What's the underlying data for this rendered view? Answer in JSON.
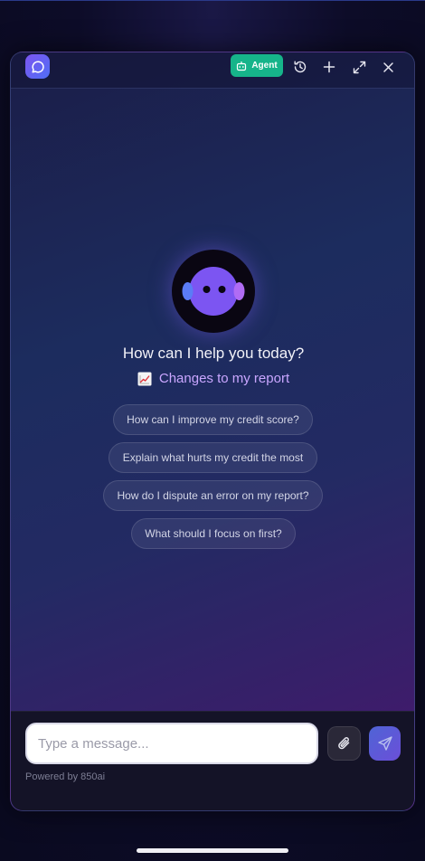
{
  "header": {
    "agent_label": "Agent"
  },
  "hero": {
    "greeting": "How can I help you today?",
    "report_link": "Changes to my report"
  },
  "suggestions": [
    "How can I improve my credit score?",
    "Explain what hurts my credit the most",
    "How do I dispute an error on my report?",
    "What should I focus on first?"
  ],
  "composer": {
    "placeholder": "Type a message...",
    "powered_by": "Powered by 850ai"
  },
  "colors": {
    "agent_green": "#16b48a",
    "link_purple": "#c9a6ff",
    "accent": "#6b4fd8"
  },
  "icons": [
    "chat-bubble-icon",
    "robot-icon",
    "history-icon",
    "plus-icon",
    "expand-icon",
    "close-icon",
    "chart-up-icon",
    "paperclip-icon",
    "send-icon"
  ]
}
